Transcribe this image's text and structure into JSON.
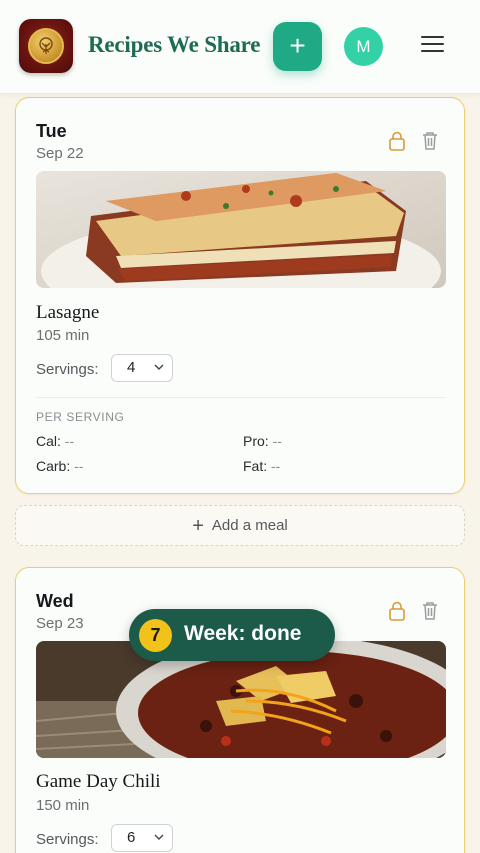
{
  "header": {
    "app_title": "Recipes We Share",
    "add_label": "+",
    "avatar_initial": "M",
    "logo_icon": "tree-medallion-icon",
    "menu_icon": "hamburger-menu-icon",
    "accent_color": "#1faa85",
    "title_color": "#1d6b53"
  },
  "days": [
    {
      "day": "Tue",
      "date": "Sep 22",
      "meal": {
        "name": "Lasagne",
        "time": "105 min",
        "servings_label": "Servings:",
        "servings_value": "4",
        "image": "lasagne-photo"
      },
      "per_serving_label": "PER SERVING",
      "nutrition": {
        "cal_label": "Cal:",
        "cal_value": "--",
        "pro_label": "Pro:",
        "pro_value": "--",
        "carb_label": "Carb:",
        "carb_value": "--",
        "fat_label": "Fat:",
        "fat_value": "--"
      }
    },
    {
      "day": "Wed",
      "date": "Sep 23",
      "meal": {
        "name": "Game Day Chili",
        "time": "150 min",
        "servings_label": "Servings:",
        "servings_value": "6",
        "image": "chili-photo"
      }
    }
  ],
  "add_meal_label": "Add a meal",
  "toast": {
    "badge": "7",
    "text": "Week: done"
  },
  "card_border_color": "#e9cf72"
}
